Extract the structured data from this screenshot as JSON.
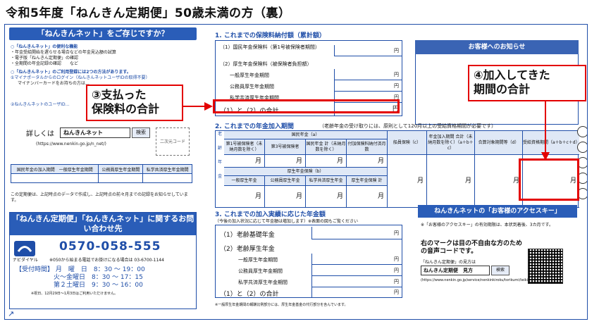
{
  "title": "令和5年度「ねんきん定期便」50歳未満の方（裏）",
  "left": {
    "header": "「ねんきんネット」をご存じですか？",
    "features_title": "○「ねんきんネット」の便利な機能",
    "features": [
      "・年金受給開始を遅らせる場合などの年金見込額の試算",
      "・電子版「ねんきん定期便」の確認",
      "・全期間の年金記録の確認　　など"
    ],
    "usage_title": "○「ねんきんネット」のご利用登録には2つの方法があります。",
    "usage_1": "①マイナポータルからのログイン（ねんきんネットユーザIDの取得不要）",
    "usage_1b": "マイナンバーカードをお持ちの方は…",
    "usage_2": "②ねんきんネットのユーザID…",
    "detail_label": "詳しくは",
    "search_value": "ねんきんネット",
    "search_button": "検索",
    "detail_url": "(https://www.nenkin.go.jp/n_net/)",
    "qr_label": "二次元コード",
    "table_headers": [
      "国民年金の加入期間　一般厚生年金期間",
      "公務員厚生年金期間",
      "私学共済厚生年金期間"
    ],
    "data_note": "この定期便は、上記時点のデータで作成し、上記時点の前々月までの記録をお知らせしています。",
    "contact_title": "「ねんきん定期便」「ねんきんネット」に関するお問い合わせ先",
    "navi_label": "ナビダイヤル",
    "phone": "0570-058-555",
    "phone_note": "※050から始まる電話でお掛けになる場合は 03-6700-1144",
    "hours_label": "【受付時間】",
    "hours": [
      "月　曜　日　8：30 ～ 19：00",
      "火～金曜日　8：30 ～ 17：15",
      "第２土曜日　9：30 ～ 16：00"
    ],
    "hours_note": "※祝日、12月29日～1月3日はご利用いただけません。"
  },
  "sec1": {
    "title": "1. これまでの保険料納付額（累計額）",
    "rows": [
      {
        "label": "（1）国民年金保険料（第1号被保険者期間）",
        "unit": "円"
      },
      {
        "label": "（2）厚生年金保険料（被保険者負担額）",
        "unit": ""
      },
      {
        "label": "一般厚生年金期間",
        "unit": "円"
      },
      {
        "label": "公務員厚生年金期間",
        "unit": "円"
      },
      {
        "label": "私学共済厚生年金期間",
        "unit": "円"
      },
      {
        "label": "（1）と（2）の合計",
        "unit": "円"
      }
    ]
  },
  "notice": {
    "title": "お客様へのお知らせ"
  },
  "sec2": {
    "title": "2. これまでの年金加入期間",
    "subtitle": "（老齢年金の受け取りには、原則として120月以上の受給資格期間が必要です）",
    "h_national": "国民年金（a）",
    "h_cols": [
      "第1号被保険者（未納月数を除く）",
      "第3号被保険者",
      "国民年金 計（未納月数を除く）",
      "付加保険料納付済月数",
      "船員保険（c）",
      "年金加入期間 合計（未納月数を除く）（a＋b＋c）",
      "合算対象期間等（d）",
      "受給資格期間（a＋b＋c＋d）"
    ],
    "h_welfare": "厚生年金保険（b）",
    "h_wcols": [
      "一般厚生年金",
      "公務員厚生年金",
      "私学共済厚生年金",
      "厚生年金保険 計"
    ],
    "unit": "月",
    "side": [
      "老",
      "齢",
      "年",
      "金"
    ]
  },
  "sec3": {
    "title": "3. これまでの加入実績に応じた年金額",
    "subtitle": "（今後の加入状況に応じて年金額は増加します）※表面の図もご覧ください",
    "rows": [
      {
        "label": "（1）老齢基礎年金",
        "unit": "円"
      },
      {
        "label": "（2）老齢厚生年金",
        "unit": ""
      },
      {
        "label": "一般厚生年金期間",
        "unit": "円"
      },
      {
        "label": "公務員厚生年金期間",
        "unit": "円"
      },
      {
        "label": "私学共済厚生年金期間",
        "unit": "円"
      },
      {
        "label": "（1）と（2）の合計",
        "unit": "円"
      }
    ],
    "footnote": "※一般厚生年金期間の報酬比例部分には、厚生年金基金の代行部分を含んでいます。"
  },
  "access": {
    "title": "ねんきんネットの「お客様のアクセスキー」",
    "note": "※「お客様のアクセスキー」の有効期限は、本状到着後、3カ月です。",
    "voice_code": "右のマークは目の不自由な方のための音声コードです。",
    "voice_sub": "「ねんきん定期便」の見方は",
    "search_value": "ねんきん定期便　見方",
    "search_button": "検索",
    "url": "(https://www.nenkin.go.jp/service/nenkinkiroku/torikumi/teikibin/teikibin.html)"
  },
  "callouts": {
    "c1": "③支払った保険料の合計",
    "c1_line1": "③支払った",
    "c1_line2": "保険料の合計",
    "c2_line1": "④加入してきた",
    "c2_line2": "期間の合計"
  },
  "colors": {
    "accent": "#1f4ea8",
    "header": "#2a5db8",
    "callout": "#e30000"
  }
}
